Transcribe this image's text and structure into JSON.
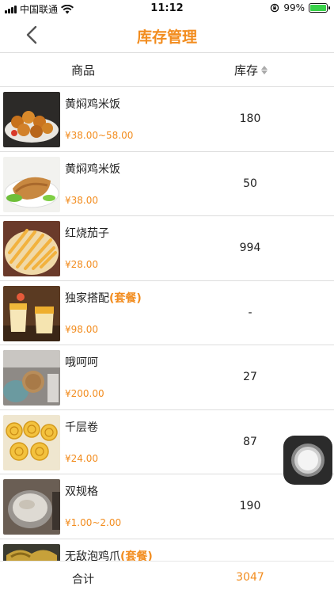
{
  "status_bar": {
    "carrier": "中国联通",
    "time": "11:12",
    "battery": "99%",
    "battery_level": 0.99
  },
  "nav": {
    "title": "库存管理"
  },
  "table": {
    "col_product": "商品",
    "col_stock": "库存"
  },
  "items": [
    {
      "name": "黄焖鸡米饭",
      "tag": "",
      "price": "¥38.00~58.00",
      "stock": "180",
      "image": "fried-chicken-balls"
    },
    {
      "name": "黄焖鸡米饭",
      "tag": "",
      "price": "¥38.00",
      "stock": "50",
      "image": "fried-chicken-cutlet"
    },
    {
      "name": "红烧茄子",
      "tag": "",
      "price": "¥28.00",
      "stock": "994",
      "image": "french-fries"
    },
    {
      "name": "独家搭配",
      "tag": "(套餐)",
      "price": "¥98.00",
      "stock": "-",
      "image": "pudding-cups"
    },
    {
      "name": "哦呵呵",
      "tag": "",
      "price": "¥200.00",
      "stock": "27",
      "image": "bread-roll"
    },
    {
      "name": "千层卷",
      "tag": "",
      "price": "¥24.00",
      "stock": "87",
      "image": "swirl-rolls"
    },
    {
      "name": "双规格",
      "tag": "",
      "price": "¥1.00~2.00",
      "stock": "190",
      "image": "bowl-of-soup"
    },
    {
      "name": "无敌泡鸡爪",
      "tag": "(套餐)",
      "price": "",
      "stock": "",
      "image": "chicken-feet"
    }
  ],
  "footer": {
    "total_label": "合计",
    "total_value": "3047"
  },
  "colors": {
    "accent": "#f28c1e",
    "battery": "#3ad24a"
  }
}
